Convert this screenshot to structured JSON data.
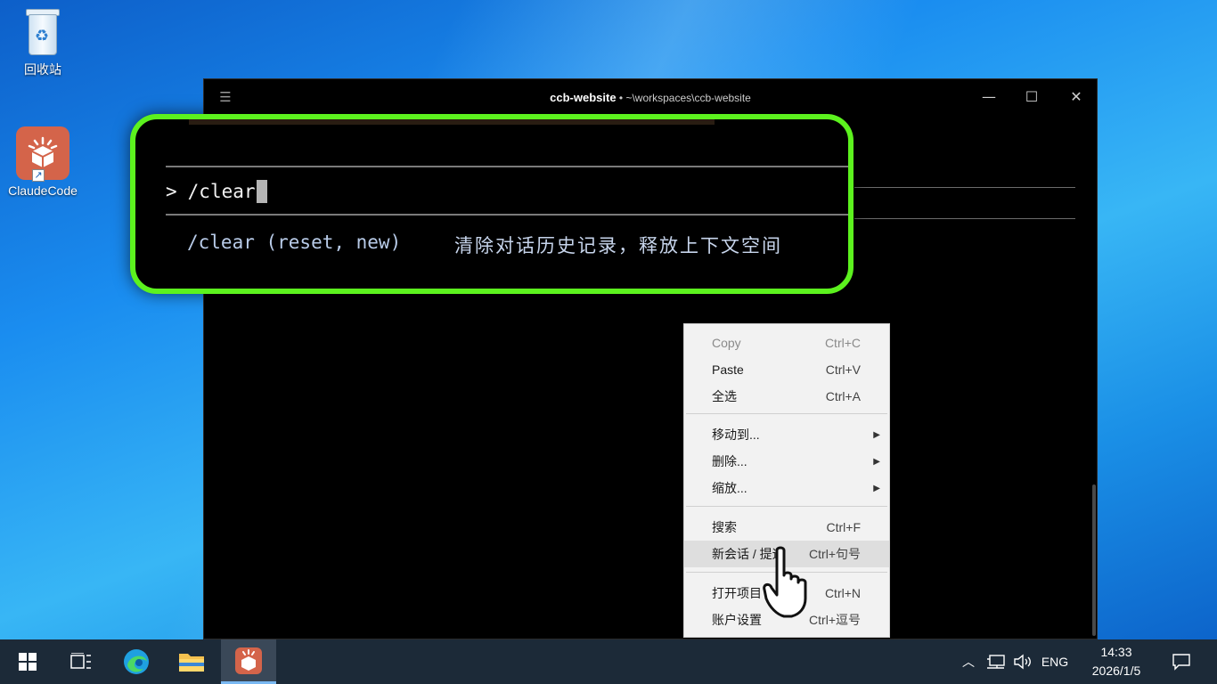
{
  "desktop": {
    "icons": [
      {
        "label": "回收站",
        "icon": "recycle-bin-icon"
      },
      {
        "label": "ClaudeCode",
        "icon": "claude-code-icon"
      }
    ]
  },
  "terminal": {
    "title": "ccb-website",
    "title_sep": " • ",
    "path": "~\\workspaces\\ccb-website",
    "prompt_symbol": ">",
    "input_text": "/clear",
    "suggestion": {
      "command": "/clear (reset, new)",
      "description": "清除对话历史记录，释放上下文空间"
    }
  },
  "context_menu": {
    "items": [
      {
        "label": "Copy",
        "shortcut": "Ctrl+C",
        "disabled": true
      },
      {
        "label": "Paste",
        "shortcut": "Ctrl+V"
      },
      {
        "label": "全选",
        "shortcut": "Ctrl+A"
      },
      {
        "label": "移动到...",
        "submenu": true
      },
      {
        "label": "删除...",
        "submenu": true
      },
      {
        "label": "缩放...",
        "submenu": true
      },
      {
        "label": "搜索",
        "shortcut": "Ctrl+F"
      },
      {
        "label": "新会话 / 提速",
        "shortcut": "Ctrl+句号",
        "highlighted": true
      },
      {
        "label": "打开项目",
        "shortcut": "Ctrl+N"
      },
      {
        "label": "账户设置",
        "shortcut": "Ctrl+逗号"
      }
    ]
  },
  "taskbar": {
    "language": "ENG",
    "time": "14:33",
    "date": "2026/1/5"
  },
  "colors": {
    "highlight_border": "#5cf21e",
    "terminal_bg": "#000000",
    "taskbar_bg": "#1c2a38"
  }
}
